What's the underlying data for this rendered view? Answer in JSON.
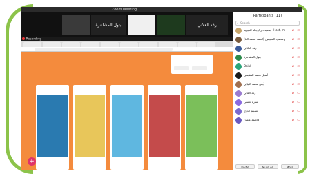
{
  "zoom": {
    "window_title": "Zoom Meeting",
    "recording_label": "Recording",
    "gallery": [
      {
        "name": ""
      },
      {
        "name": "بتول المشاعرة"
      },
      {
        "name": ""
      },
      {
        "name": ""
      },
      {
        "name": "رغد العلاني"
      }
    ]
  },
  "participants": {
    "title": "Participants (11)",
    "search_placeholder": "Search",
    "list": [
      {
        "name": "جمعية دار ارجاله الخيرية (Host, me)",
        "color": "#c7a56b"
      },
      {
        "name": "أدهم محمود المقيمين (الحمد محمد الغا)",
        "color": "#7a5c3e"
      },
      {
        "name": "رغد العلاني",
        "color": "#3b5b9a"
      },
      {
        "name": "بتول المشاعرة",
        "color": "#2b8a4b"
      },
      {
        "name": "Dalal",
        "color": "#2ba57a"
      },
      {
        "name": "أسيل محمد المقيمين",
        "color": "#1b1b1b"
      },
      {
        "name": "أيمن محمد الليابي",
        "color": "#a07050"
      },
      {
        "name": "رغد الغاني",
        "color": "#9a7bd0"
      },
      {
        "name": "سارة عيسى",
        "color": "#8a6ae0"
      },
      {
        "name": "تسنيم الدباغ",
        "color": "#7a6ad0"
      },
      {
        "name": "فاطمة عثمان",
        "color": "#6a5ac0"
      }
    ],
    "invite_label": "Invite",
    "mute_all_label": "Mute All",
    "more_label": "More"
  },
  "colors": {
    "padlet_bg": "#f48b3d",
    "accent_green": "#8cc34a",
    "fab": "#e0336a"
  }
}
